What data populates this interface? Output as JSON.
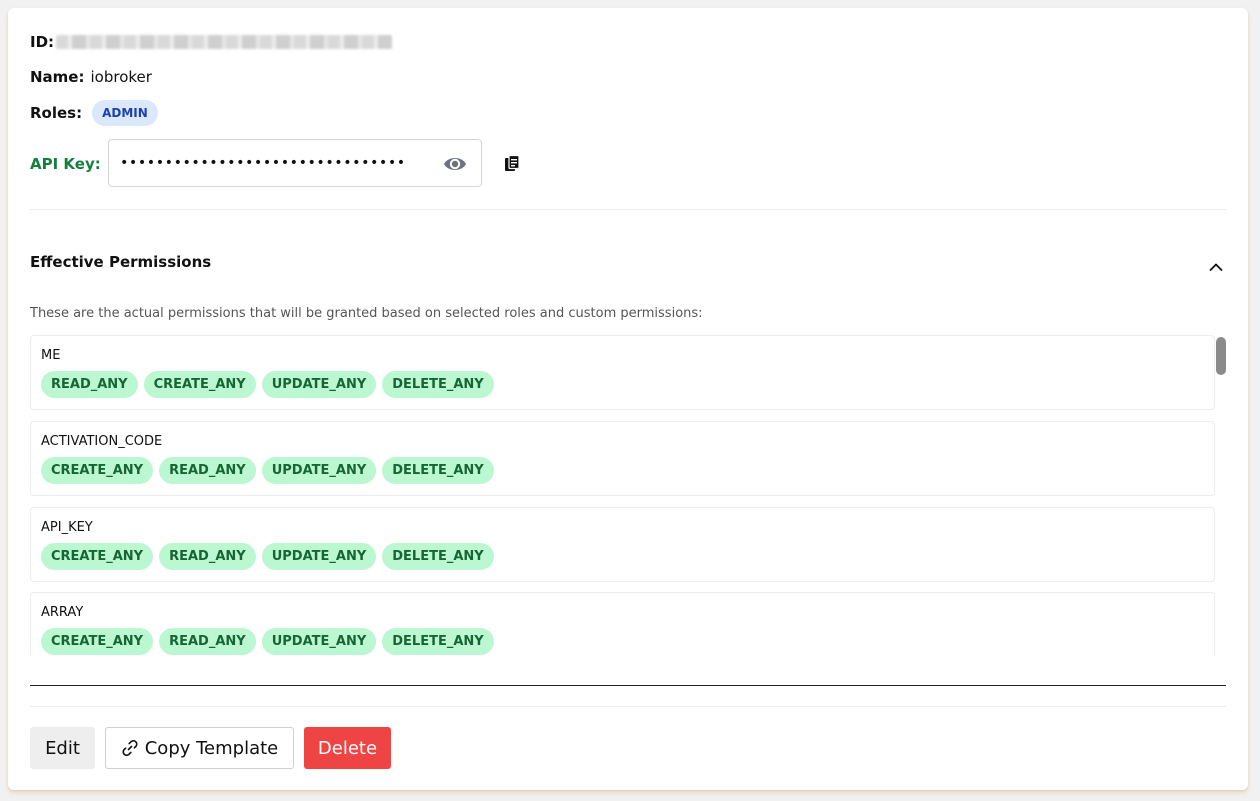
{
  "details": {
    "id_label": "ID:",
    "name_label": "Name:",
    "name_value": "iobroker",
    "roles_label": "Roles:",
    "roles": [
      "ADMIN"
    ],
    "api_key_label": "API Key:",
    "api_key_masked": "••••••••••••••••••••••••••••••••"
  },
  "permissions": {
    "title": "Effective Permissions",
    "description": "These are the actual permissions that will be granted based on selected roles and custom permissions:",
    "items": [
      {
        "name": "ME",
        "actions": [
          "READ_ANY",
          "CREATE_ANY",
          "UPDATE_ANY",
          "DELETE_ANY"
        ]
      },
      {
        "name": "ACTIVATION_CODE",
        "actions": [
          "CREATE_ANY",
          "READ_ANY",
          "UPDATE_ANY",
          "DELETE_ANY"
        ]
      },
      {
        "name": "API_KEY",
        "actions": [
          "CREATE_ANY",
          "READ_ANY",
          "UPDATE_ANY",
          "DELETE_ANY"
        ]
      },
      {
        "name": "ARRAY",
        "actions": [
          "CREATE_ANY",
          "READ_ANY",
          "UPDATE_ANY",
          "DELETE_ANY"
        ]
      }
    ]
  },
  "actions": {
    "edit_label": "Edit",
    "copy_template_label": "Copy Template",
    "delete_label": "Delete"
  },
  "colors": {
    "api_key_label": "#15803d",
    "role_badge_bg": "#dbe7fb",
    "permission_chip_bg": "#bbf7d0",
    "delete_button": "#ef4444"
  },
  "icons": {
    "api_key_visibility": "eye-icon",
    "api_key_copy": "copy-icon",
    "collapse": "chevron-up-icon",
    "copy_template": "link-icon"
  }
}
